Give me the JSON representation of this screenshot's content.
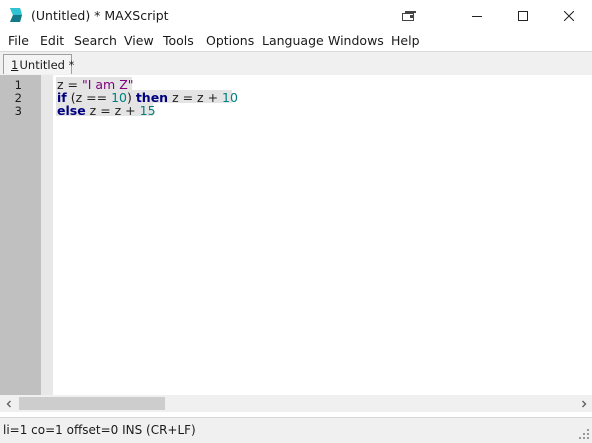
{
  "window": {
    "title": "(Untitled) * MAXScript"
  },
  "menu": [
    "File",
    "Edit",
    "Search",
    "View",
    "Tools",
    "Options",
    "Language",
    "Windows",
    "Help"
  ],
  "tabs": [
    {
      "number": "1",
      "label": "Untitled *"
    }
  ],
  "editor": {
    "line_numbers": [
      "1",
      "2",
      "3"
    ],
    "lines": [
      [
        {
          "t": "z",
          "c": "ident"
        },
        {
          "t": " = ",
          "c": "op"
        },
        {
          "t": "\"I am Z\"",
          "c": "str"
        }
      ],
      [
        {
          "t": "if",
          "c": "kw"
        },
        {
          "t": " (",
          "c": "op"
        },
        {
          "t": "z",
          "c": "ident"
        },
        {
          "t": " == ",
          "c": "op"
        },
        {
          "t": "10",
          "c": "num"
        },
        {
          "t": ") ",
          "c": "op"
        },
        {
          "t": "then",
          "c": "kw"
        },
        {
          "t": " z = z + ",
          "c": "op"
        },
        {
          "t": "10",
          "c": "num"
        }
      ],
      [
        {
          "t": "else",
          "c": "kw"
        },
        {
          "t": " z = z + ",
          "c": "op"
        },
        {
          "t": "15",
          "c": "num"
        }
      ]
    ]
  },
  "status": {
    "text": "li=1 co=1 offset=0 INS (CR+LF)"
  },
  "colors": {
    "keyword": "#000080",
    "string": "#7f007f",
    "number": "#008080",
    "gutter": "#c0c0c0"
  },
  "icons": [
    "maxscript-app-icon",
    "restore-icon",
    "minimize-icon",
    "maximize-icon",
    "close-icon",
    "scroll-left-icon",
    "scroll-right-icon",
    "resize-grip-icon"
  ]
}
